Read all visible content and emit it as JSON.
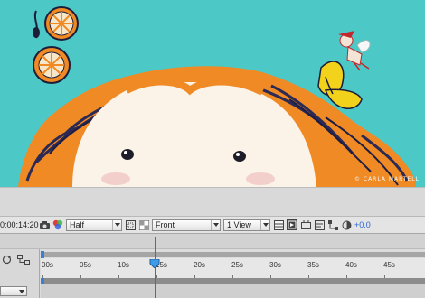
{
  "viewer": {
    "watermark": "© CARLA MARTELL",
    "background": "#4cc8c7"
  },
  "toolbar": {
    "timecode": "0:00:14:20",
    "resolution": "Half",
    "view": "Front",
    "layout": "1 View",
    "exposure": "+0.0",
    "icons": [
      "camera-icon",
      "color-channels-icon",
      "region-of-interest-icon",
      "transparency-grid-icon",
      "grid-guides-icon",
      "fast-preview-icon",
      "toggle-pixel-aspect-icon",
      "timeline-icon",
      "flowchart-icon",
      "exposure-reset-icon"
    ]
  },
  "timeline": {
    "ruler_labels": [
      "00s",
      "05s",
      "10s",
      "15s",
      "20s",
      "25s",
      "30s",
      "35s",
      "40s",
      "45s"
    ],
    "current_time_seconds": 14.8,
    "icons": [
      "loop-icon",
      "comp-mini-flowchart-icon"
    ]
  }
}
